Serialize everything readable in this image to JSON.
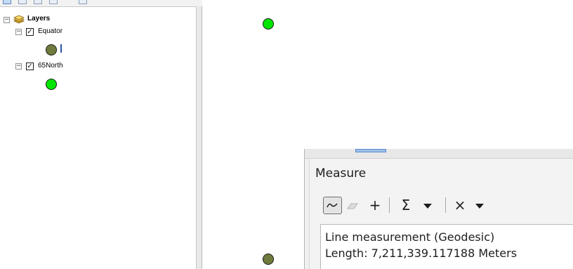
{
  "toc": {
    "root_label": "Layers",
    "layers": [
      {
        "name": "Equator",
        "checked": true
      },
      {
        "name": "65North",
        "checked": true
      }
    ]
  },
  "measure": {
    "title": "Measure",
    "result_mode": "Line measurement (Geodesic)",
    "result_length": "Length: 7,211,339.117188 Meters",
    "tools": {
      "line_icon": "measure-line-icon",
      "area_icon": "measure-area-icon",
      "feature_symbol": "+",
      "sum_symbol": "Σ",
      "clear_symbol": "×"
    }
  },
  "colors": {
    "equator_symbol": "#6e7b3c",
    "north_symbol": "#00e600",
    "symbol_outline": "#1a1a1a",
    "equator_marker": "#2e55a8"
  }
}
